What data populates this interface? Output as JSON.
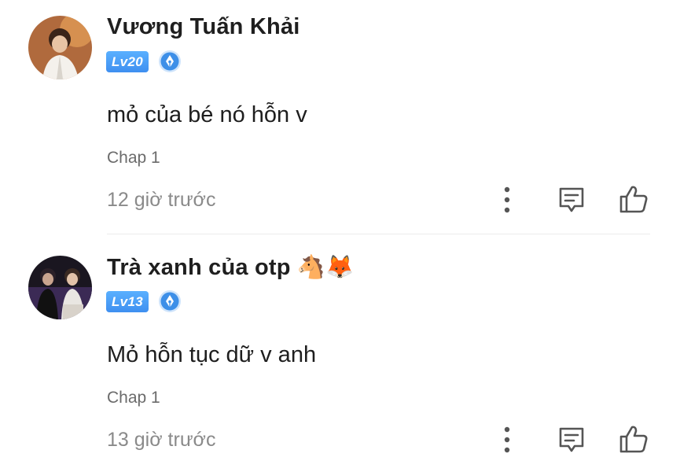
{
  "comments": [
    {
      "username": "Vương Tuấn Khải",
      "level": "Lv20",
      "text": "mỏ của bé nó hỗn v",
      "chapter": "Chap 1",
      "time": "12 giờ trước"
    },
    {
      "username": "Trà xanh của otp 🐴🦊",
      "level": "Lv13",
      "text": "Mỏ hỗn tục dữ v anh",
      "chapter": "Chap 1",
      "time": "13 giờ trước"
    }
  ],
  "icons": {
    "more": "more-vertical-icon",
    "reply": "chat-bubble-icon",
    "like": "thumbs-up-icon",
    "rank": "pen-nib-badge-icon"
  },
  "colors": {
    "level_badge": "#4a9af5",
    "rank_badge": "#3d8fe8",
    "icon_gray": "#555555"
  }
}
